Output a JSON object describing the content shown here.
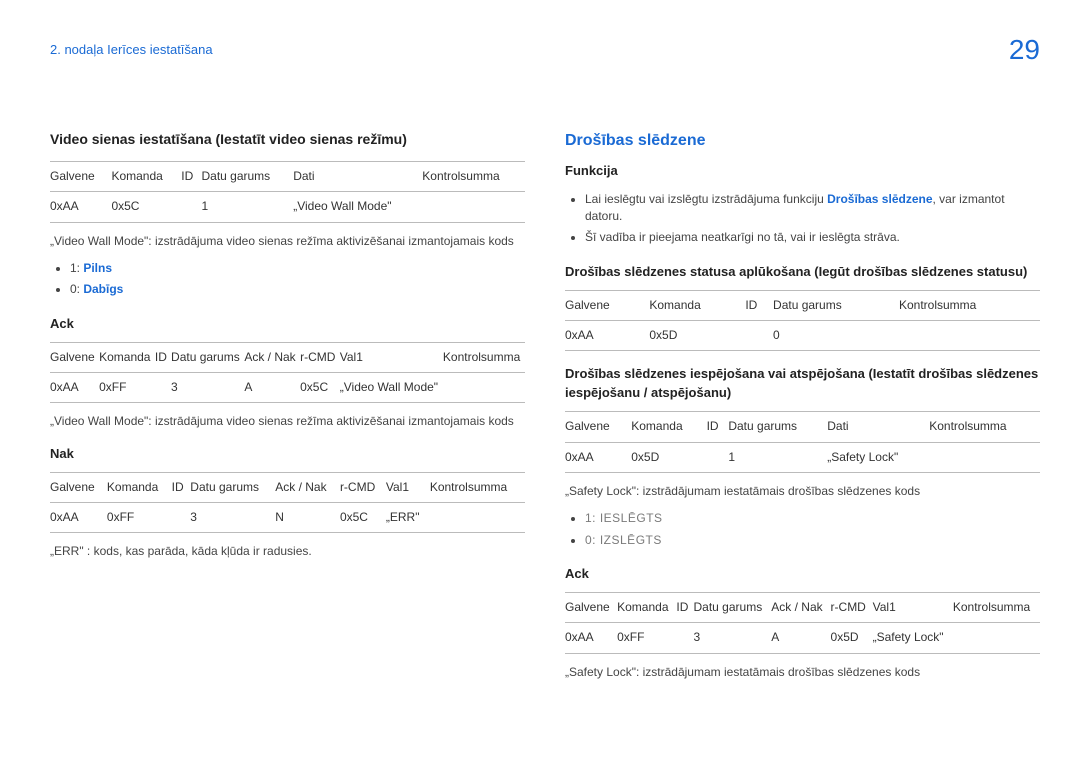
{
  "header": {
    "chapter": "2. nodaļa Ierīces iestatīšana",
    "page_number": "29"
  },
  "left": {
    "title": "Video sienas iestatīšana (Iestatīt video sienas režīmu)",
    "table1": {
      "head": [
        "Galvene",
        "Komanda",
        "ID",
        "Datu garums",
        "Dati",
        "Kontrolsumma"
      ],
      "row": [
        "0xAA",
        "0x5C",
        "",
        "1",
        "„Video Wall Mode\"",
        ""
      ]
    },
    "note1": "„Video Wall Mode\": izstrādājuma video sienas režīma aktivizēšanai izmantojamais kods",
    "bullets1": [
      {
        "pre": "1: ",
        "hl": "Pilns"
      },
      {
        "pre": "0: ",
        "hl": "Dabīgs"
      }
    ],
    "ack_title": "Ack",
    "ack_table": {
      "head": [
        "Galvene",
        "Komanda",
        "ID",
        "Datu garums",
        "Ack / Nak",
        "r-CMD",
        "Val1",
        "Kontrolsumma"
      ],
      "row": [
        "0xAA",
        "0xFF",
        "",
        "3",
        "A",
        "0x5C",
        "„Video Wall Mode\"",
        ""
      ]
    },
    "note2": "„Video Wall Mode\": izstrādājuma video sienas režīma aktivizēšanai izmantojamais kods",
    "nak_title": "Nak",
    "nak_table": {
      "head": [
        "Galvene",
        "Komanda",
        "ID",
        "Datu garums",
        "Ack / Nak",
        "r-CMD",
        "Val1",
        "Kontrolsumma"
      ],
      "row": [
        "0xAA",
        "0xFF",
        "",
        "3",
        "N",
        "0x5C",
        "„ERR\"",
        ""
      ]
    },
    "err_note": "„ERR\" : kods, kas parāda, kāda kļūda ir radusies."
  },
  "right": {
    "title": "Drošības slēdzene",
    "func_title": "Funkcija",
    "func_bullets": [
      {
        "pre": "Lai ieslēgtu vai izslēgtu izstrādājuma funkciju ",
        "hl": "Drošības slēdzene",
        "post": ", var izmantot datoru."
      },
      {
        "pre": "Šī vadība ir pieejama neatkarīgi no tā, vai ir ieslēgta strāva.",
        "hl": "",
        "post": ""
      }
    ],
    "status_title": "Drošības slēdzenes statusa aplūkošana (Iegūt drošības slēdzenes statusu)",
    "status_table": {
      "head": [
        "Galvene",
        "Komanda",
        "ID",
        "Datu garums",
        "Kontrolsumma"
      ],
      "row": [
        "0xAA",
        "0x5D",
        "",
        "0",
        ""
      ]
    },
    "set_title": "Drošības slēdzenes iespējošana vai atspējošana (Iestatīt drošības slēdzenes iespējošanu / atspējošanu)",
    "set_table": {
      "head": [
        "Galvene",
        "Komanda",
        "ID",
        "Datu garums",
        "Dati",
        "Kontrolsumma"
      ],
      "row": [
        "0xAA",
        "0x5D",
        "",
        "1",
        "„Safety Lock\"",
        ""
      ]
    },
    "sl_note": "„Safety Lock\": izstrādājumam iestatāmais drošības slēdzenes kods",
    "sl_bullets": [
      "1: IESLĒGTS",
      "0: IZSLĒGTS"
    ],
    "ack_title": "Ack",
    "ack_table": {
      "head": [
        "Galvene",
        "Komanda",
        "ID",
        "Datu garums",
        "Ack / Nak",
        "r-CMD",
        "Val1",
        "Kontrolsumma"
      ],
      "row": [
        "0xAA",
        "0xFF",
        "",
        "3",
        "A",
        "0x5D",
        "„Safety Lock\"",
        ""
      ]
    },
    "ack_note": "„Safety Lock\": izstrādājumam iestatāmais drošības slēdzenes kods"
  }
}
